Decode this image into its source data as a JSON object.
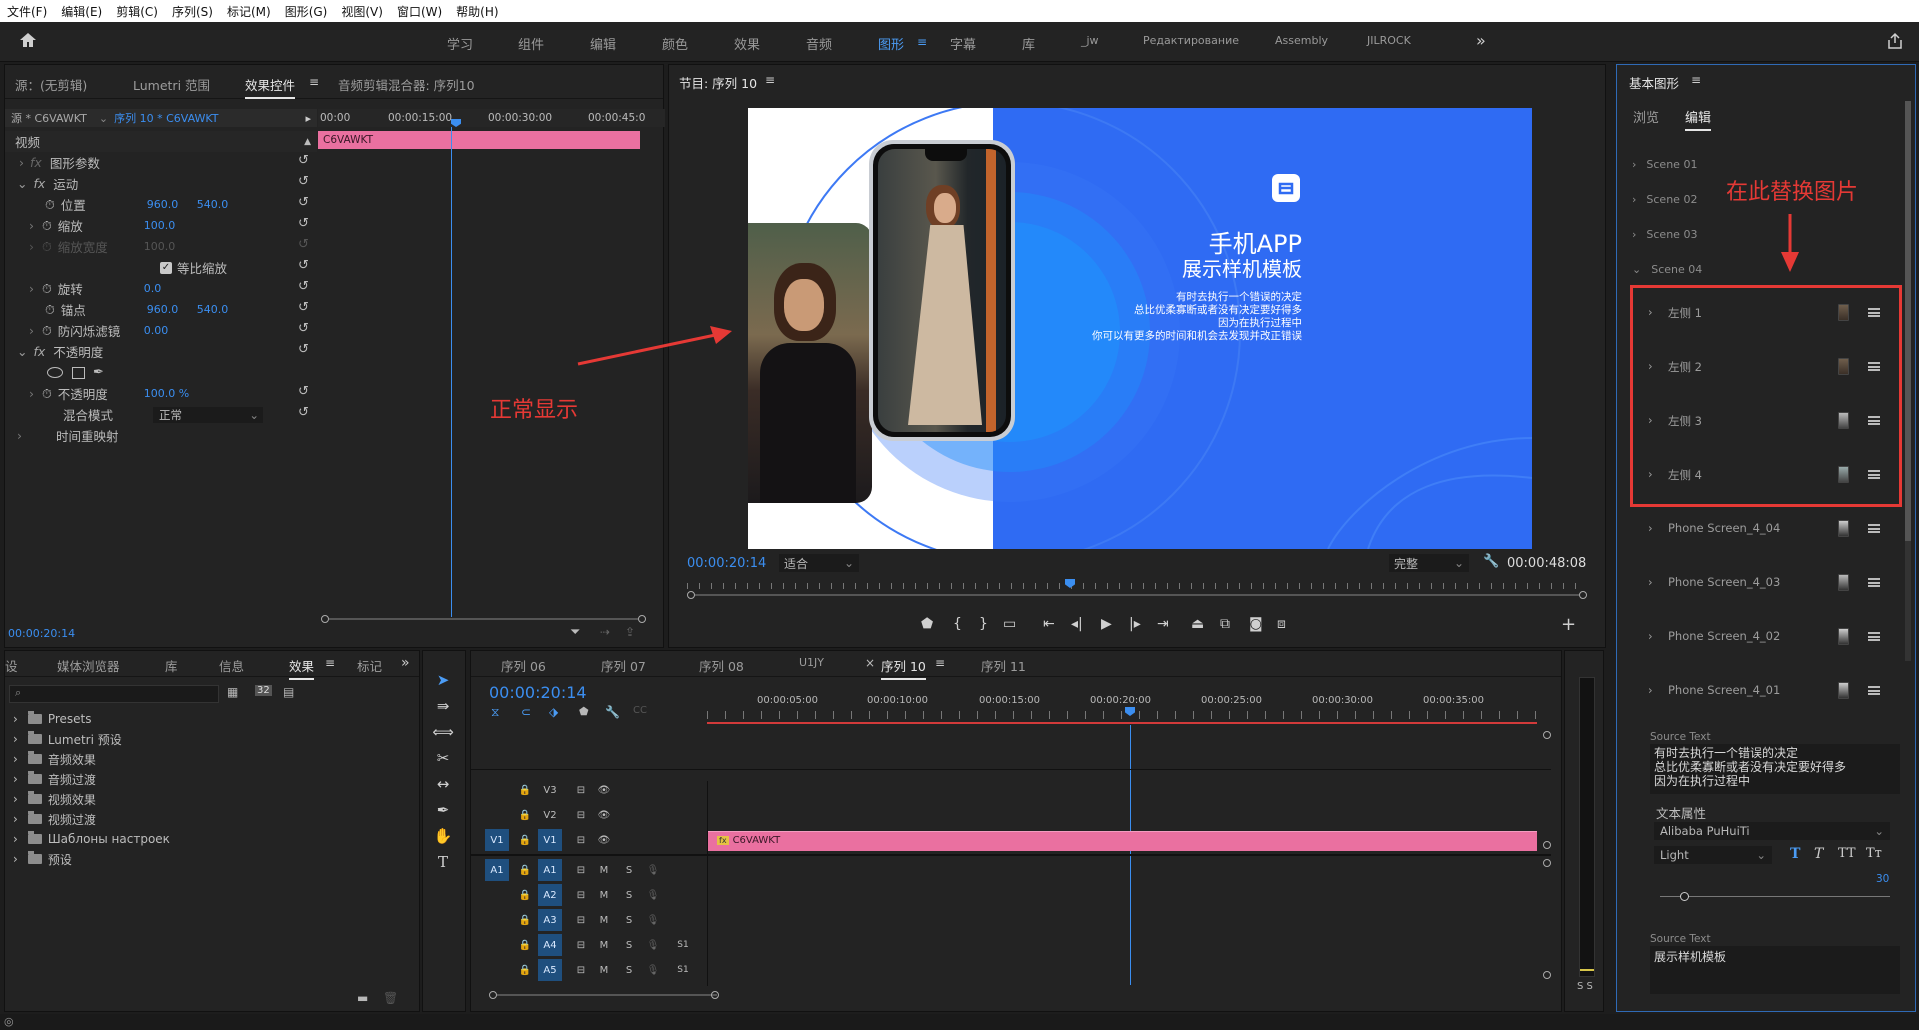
{
  "menu": [
    "文件(F)",
    "编辑(E)",
    "剪辑(C)",
    "序列(S)",
    "标记(M)",
    "图形(G)",
    "视图(V)",
    "窗口(W)",
    "帮助(H)"
  ],
  "workspaces": [
    "学习",
    "组件",
    "编辑",
    "颜色",
    "效果",
    "音频",
    "图形",
    "字幕",
    "库",
    "_jw",
    "Редактирование",
    "Assembly",
    "JILROCK"
  ],
  "effects_panel": {
    "tabs": [
      "源：(无剪辑)",
      "Lumetri 范围",
      "效果控件",
      "音频剪辑混合器: 序列10"
    ],
    "source_label": "源 * C6VAWKT",
    "sequence_label": "序列 10 * C6VAWKT",
    "ruler": [
      "00:00",
      "00:00:15:00",
      "00:00:30:00",
      "00:00:45:0"
    ],
    "clip_name": "C6VAWKT",
    "video_header": "视频",
    "graphic_params": "图形参数",
    "motion": "运动",
    "position_label": "位置",
    "position_x": "960.0",
    "position_y": "540.0",
    "scale_label": "缩放",
    "scale_value": "100.0",
    "scale_width_label": "缩放宽度",
    "scale_width_value": "100.0",
    "uniform_scale": "等比缩放",
    "rotation_label": "旋转",
    "rotation_value": "0.0",
    "anchor_label": "锚点",
    "anchor_x": "960.0",
    "anchor_y": "540.0",
    "antiflicker_label": "防闪烁滤镜",
    "antiflicker_value": "0.00",
    "opacity": "不透明度",
    "opacity_label": "不透明度",
    "opacity_value": "100.0 %",
    "blend_label": "混合模式",
    "blend_value": "正常",
    "time_remap": "时间重映射",
    "timecode": "00:00:20:14"
  },
  "program": {
    "title": "节目: 序列 10",
    "timecode": "00:00:20:14",
    "fit": "适合",
    "quality": "完整",
    "duration": "00:00:48:08",
    "slide_title": "手机APP",
    "slide_subtitle": "展示样机模板",
    "slide_lines": [
      "有时去执行一个错误的决定",
      "总比优柔寡断或者没有决定要好得多",
      "因为在执行过程中",
      "你可以有更多的时间和机会去发现并改正错误"
    ],
    "accent": "#2f6bf3"
  },
  "annotations": {
    "normal_display": "正常显示",
    "replace_here": "在此替换图片"
  },
  "project_panel": {
    "tabs": [
      "设",
      "媒体浏览器",
      "库",
      "信息",
      "效果",
      "标记"
    ],
    "folders": [
      "Presets",
      "Lumetri 预设",
      "音频效果",
      "音频过渡",
      "视频效果",
      "视频过渡",
      "Шаблоны настроек",
      "预设"
    ]
  },
  "timeline": {
    "tabs": [
      "序列 06",
      "序列 07",
      "序列 08",
      "U1JY",
      "序列 10",
      "序列 11"
    ],
    "timecode": "00:00:20:14",
    "ruler": [
      "00:00:05:00",
      "00:00:10:00",
      "00:00:15:00",
      "00:00:20:00",
      "00:00:25:00",
      "00:00:30:00",
      "00:00:35:00"
    ],
    "video_tracks": [
      "V3",
      "V2",
      "V1"
    ],
    "audio_tracks": [
      "A1",
      "A2",
      "A3",
      "A4",
      "A5"
    ],
    "clip_name": "C6VAWKT",
    "mute": "M",
    "solo": "S",
    "s1": "S1"
  },
  "essential_graphics": {
    "title": "基本图形",
    "tabs": [
      "浏览",
      "编辑"
    ],
    "scenes": [
      "Scene 01",
      "Scene 02",
      "Scene 03",
      "Scene 04"
    ],
    "layers": [
      "左侧 1",
      "左侧 2",
      "左侧 3",
      "左侧 4",
      "Phone Screen_4_04",
      "Phone Screen_4_03",
      "Phone Screen_4_02",
      "Phone Screen_4_01"
    ],
    "source_text_label": "Source Text",
    "source_text_lines": [
      "有时去执行一个错误的决定",
      "总比优柔寡断或者没有决定要好得多",
      "因为在执行过程中"
    ],
    "text_props": "文本属性",
    "font": "Alibaba PuHuiTi",
    "style": "Light",
    "size": "30",
    "source_text2_label": "Source Text",
    "source_text2": "展示样机模板"
  },
  "audio_meter": {
    "labels": "S S"
  }
}
